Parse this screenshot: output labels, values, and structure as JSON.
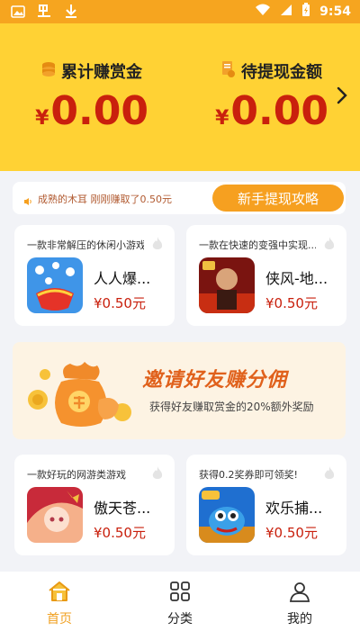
{
  "status_bar": {
    "time": "9:54"
  },
  "header": {
    "earned_label": "累计赚赏金",
    "earned_amount": "0.00",
    "pending_label": "待提现金额",
    "pending_amount": "0.00",
    "currency": "¥"
  },
  "ticker": {
    "message": "成熟的木耳 刚刚赚取了0.50元",
    "guide_button": "新手提现攻略"
  },
  "games": [
    {
      "desc": "一款非常解压的休闲小游戏",
      "name": "人人爆...",
      "price": "¥0.50元"
    },
    {
      "desc": "一款在快速的变强中实现...",
      "name": "侠风-地...",
      "price": "¥0.50元"
    },
    {
      "desc": "一款好玩的网游类游戏",
      "name": "傲天苍...",
      "price": "¥0.50元"
    },
    {
      "desc": "获得0.2奖券即可领奖!",
      "name": "欢乐捕...",
      "price": "¥0.50元"
    }
  ],
  "banner": {
    "title": "邀请好友赚分佣",
    "subtitle": "获得好友赚取赏金的20%额外奖励"
  },
  "bottom_nav": [
    {
      "label": "首页",
      "icon": "home-icon",
      "active": true
    },
    {
      "label": "分类",
      "icon": "grid-icon",
      "active": false
    },
    {
      "label": "我的",
      "icon": "user-icon",
      "active": false
    }
  ],
  "colors": {
    "accent": "#f6a020",
    "header_bg": "#ffd234",
    "amount_red": "#c9200d",
    "status_bar": "#f6a51f"
  }
}
